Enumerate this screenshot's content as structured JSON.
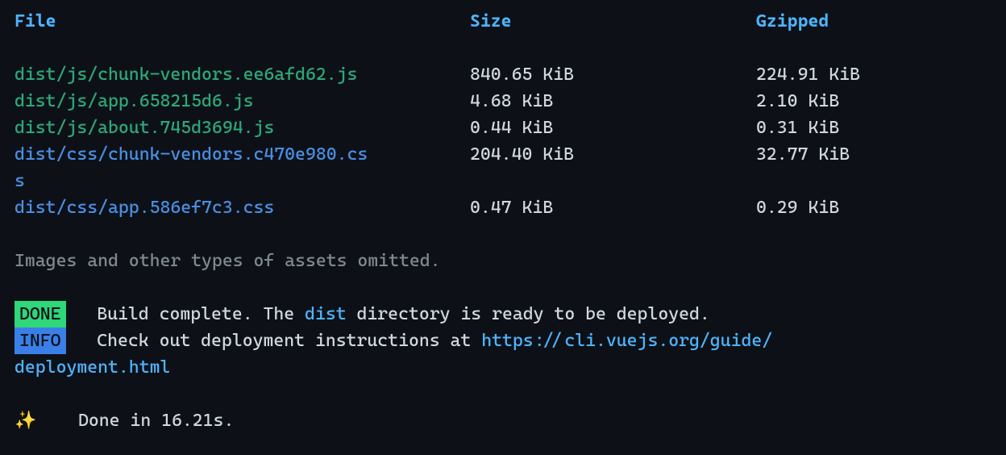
{
  "headers": {
    "file": "File",
    "size": "Size",
    "gzipped": "Gzipped"
  },
  "rows": [
    {
      "file": "dist/js/chunk-vendors.ee6afd62.js",
      "type": "js",
      "size": "840.65 KiB",
      "gzipped": "224.91 KiB"
    },
    {
      "file": "dist/js/app.658215d6.js",
      "type": "js",
      "size": "4.68 KiB",
      "gzipped": "2.10 KiB"
    },
    {
      "file": "dist/js/about.745d3694.js",
      "type": "js",
      "size": "0.44 KiB",
      "gzipped": "0.31 KiB"
    },
    {
      "file": "dist/css/chunk-vendors.c470e980.cs",
      "wrap": "s",
      "type": "css",
      "size": "204.40 KiB",
      "gzipped": "32.77 KiB"
    },
    {
      "file": "dist/css/app.586ef7c3.css",
      "type": "css",
      "size": "0.47 KiB",
      "gzipped": "0.29 KiB"
    }
  ],
  "omitted": "Images and other types of assets omitted.",
  "badges": {
    "done": " DONE ",
    "info": " INFO "
  },
  "done_line": {
    "pre": "Build complete. The ",
    "dist": "dist",
    "post": " directory is ready to be deployed."
  },
  "info_line": {
    "pre": "Check out deployment instructions at ",
    "url1": "https://cli.vuejs.org/guide/",
    "url2": "deployment.html"
  },
  "sparkle": "✨",
  "done_time": "Done in 16.21s."
}
